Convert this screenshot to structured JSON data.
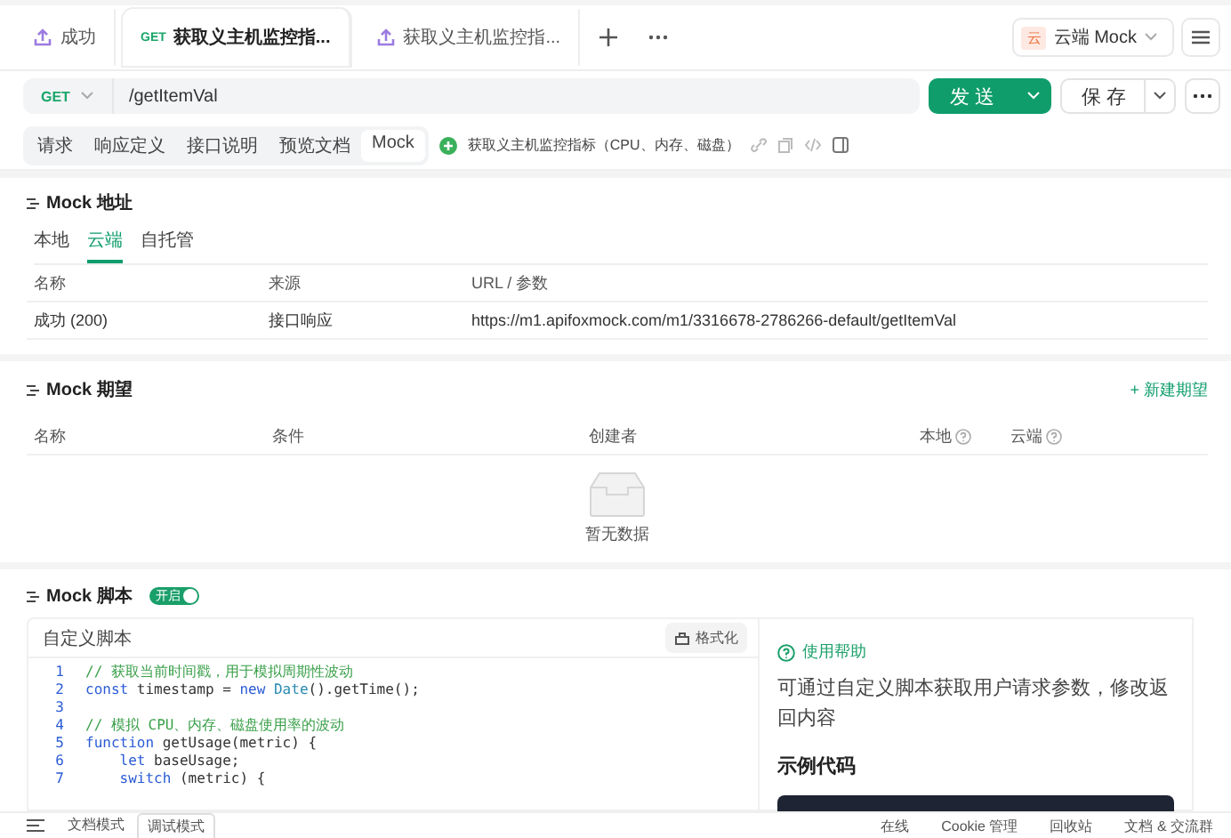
{
  "tabs": [
    {
      "label": "成功",
      "selected": false
    },
    {
      "label": "获取义主机监控指...",
      "method": "GET",
      "selected": true
    },
    {
      "label": "获取义主机监控指...",
      "selected": false
    }
  ],
  "environment": "云端 Mock",
  "env_badge": "云",
  "request": {
    "method": "GET",
    "url": "/getItemVal",
    "send": "发 送",
    "save": "保 存"
  },
  "sub_tabs": [
    {
      "label": "请求",
      "selected": false
    },
    {
      "label": "响应定义",
      "selected": false
    },
    {
      "label": "接口说明",
      "selected": false
    },
    {
      "label": "预览文档",
      "selected": false
    },
    {
      "label": "Mock",
      "selected": true
    }
  ],
  "api_title": "获取义主机监控指标（CPU、内存、磁盘）",
  "mock_address": {
    "title": "Mock 地址",
    "tabs": [
      {
        "label": "本地",
        "selected": false
      },
      {
        "label": "云端",
        "selected": true
      },
      {
        "label": "自托管",
        "selected": false
      }
    ],
    "columns": [
      "名称",
      "来源",
      "URL / 参数"
    ],
    "rows": [
      [
        "成功 (200)",
        "接口响应",
        "https://m1.apifoxmock.com/m1/3316678-2786266-default/getItemVal"
      ]
    ]
  },
  "mock_expectations": {
    "title": "Mock 期望",
    "new_button": "+ 新建期望",
    "columns": [
      "名称",
      "条件",
      "创建者",
      "本地",
      "云端"
    ],
    "empty_text": "暂无数据"
  },
  "mock_script": {
    "title": "Mock 脚本",
    "toggle_label": "开启",
    "on": true,
    "editor_title": "自定义脚本",
    "format_button": "格式化",
    "lines": [
      {
        "number": "1",
        "tokens": [
          {
            "kind": "comment",
            "text": "// 获取当前时间戳，用于模拟周期性波动"
          }
        ]
      },
      {
        "number": "2",
        "tokens": [
          {
            "kind": "keyword",
            "text": "const"
          },
          {
            "kind": "plain",
            "text": " timestamp = "
          },
          {
            "kind": "keyword",
            "text": "new"
          },
          {
            "kind": "type",
            "text": " Date"
          },
          {
            "kind": "plain",
            "text": "().getTime();"
          }
        ]
      },
      {
        "number": "3"
      },
      {
        "number": "4",
        "tokens": [
          {
            "kind": "comment",
            "text": "// 模拟 CPU、内存、磁盘使用率的波动"
          }
        ]
      },
      {
        "number": "5",
        "tokens": [
          {
            "kind": "keyword",
            "text": "function"
          },
          {
            "kind": "plain",
            "text": " getUsage(metric) {"
          }
        ]
      },
      {
        "number": "6",
        "tokens": [
          {
            "kind": "keyword",
            "text": "    let"
          },
          {
            "kind": "plain",
            "text": " baseUsage;"
          }
        ]
      },
      {
        "number": "7",
        "tokens": [
          {
            "kind": "keyword",
            "text": "    switch"
          },
          {
            "kind": "plain",
            "text": " (metric) {"
          }
        ]
      }
    ],
    "help_title": "使用帮助",
    "help_text": "可通过自定义脚本获取用户请求参数，修改返回内容",
    "example_title": "示例代码"
  },
  "status_bar": {
    "modes": [
      {
        "label": "文档模式",
        "selected": false
      },
      {
        "label": "调试模式",
        "selected": true
      }
    ],
    "items": [
      "在线",
      "Cookie 管理",
      "回收站",
      "文档 & 交流群"
    ]
  }
}
